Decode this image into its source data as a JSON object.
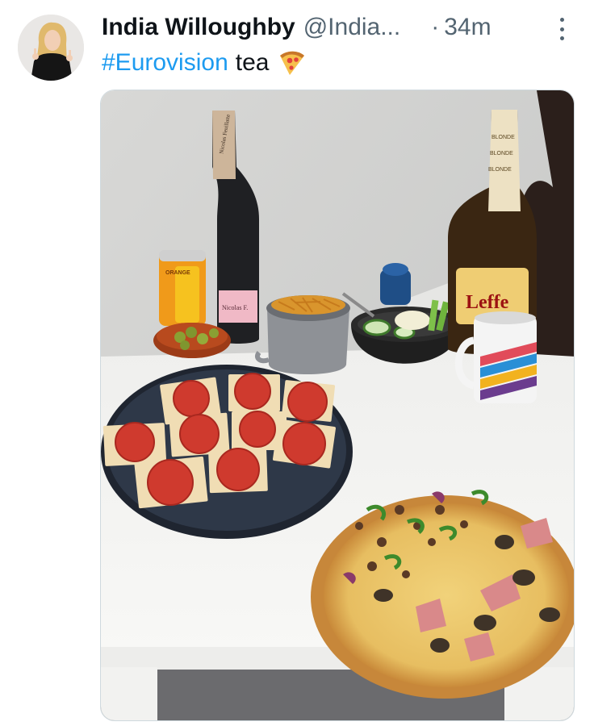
{
  "tweet": {
    "display_name": "India Willoughby",
    "handle": "@India...",
    "dot": "·",
    "timestamp": "34m",
    "hashtag": "#Eurovision",
    "text": "tea",
    "emoji_icon": "pizza-slice-emoji",
    "more_icon": "more-vertical-icon"
  },
  "media": {
    "bottle_label_top": "Nicolas Feuillatte",
    "bottle_label_pink": "Nicolas Feuillatte",
    "beer_brand": "Leffe",
    "beer_neck_text": "BLONDE",
    "can_label": "ORANGE"
  },
  "colors": {
    "hashtag": "#1d9bf0",
    "secondary_text": "#536471",
    "primary_text": "#0f1419"
  }
}
